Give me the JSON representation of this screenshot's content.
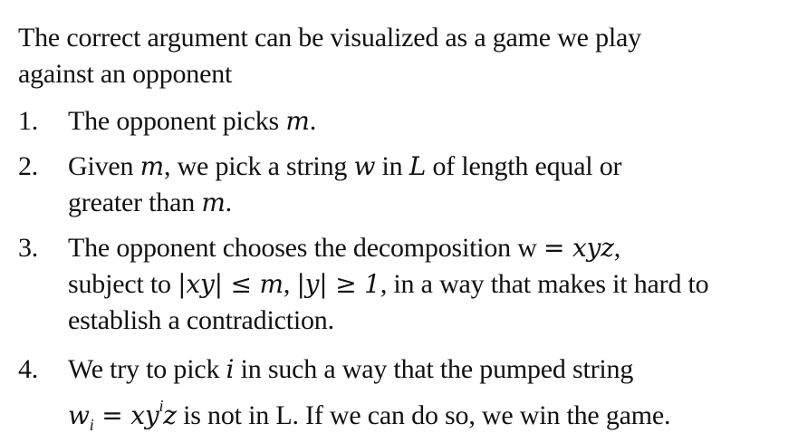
{
  "intro": {
    "line1": "The correct argument can be visualized as a game we play",
    "line2": "against an opponent"
  },
  "items": [
    {
      "number": "1.",
      "t1": "The opponent picks ",
      "m1": "m",
      "t2": "."
    },
    {
      "number": "2.",
      "t1": "Given ",
      "m1": "m",
      "t2": ", we pick a string ",
      "m2": "w",
      "t3": " in ",
      "m3": "L",
      "t4": " of length equal or",
      "t5": "greater than ",
      "m4": "m",
      "t6": "."
    },
    {
      "number": "3.",
      "t1": "The opponent chooses the decomposition w ",
      "m1": "= xyz",
      "t2": ",",
      "t3": "subject to ",
      "m2": "|xy| ≤ m",
      "t4": ", ",
      "m3": "|y| ≥ 1",
      "t5": ", in a way that makes it hard to",
      "t6": "establish a contradiction."
    },
    {
      "number": "4.",
      "t1": "We try to pick ",
      "m1": "i",
      "t2": " in such a way that the pumped string",
      "m2": "w",
      "m2sub": "i",
      "m3": " = xy",
      "m3sup": "i",
      "m4": "z",
      "t3": " is not in L. If we can do so, we win the game."
    }
  ]
}
